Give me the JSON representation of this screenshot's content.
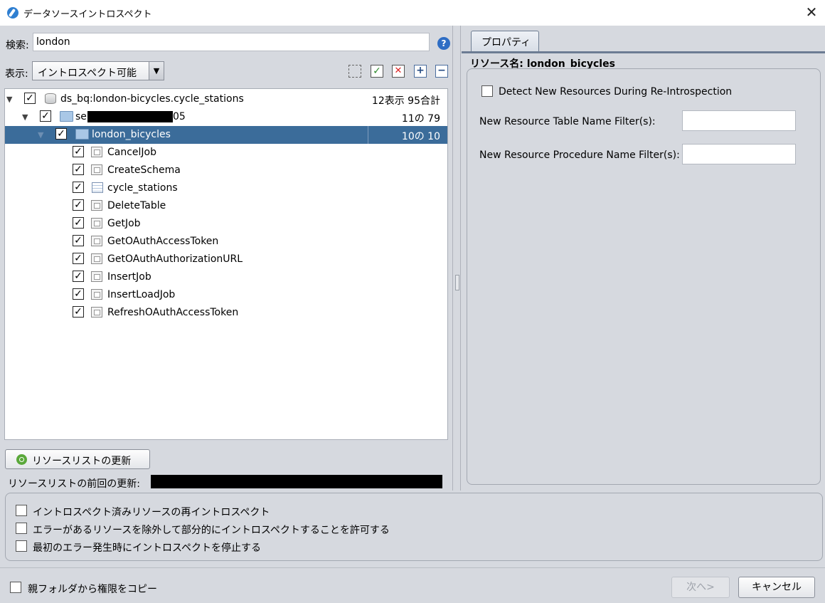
{
  "window": {
    "title": "データソースイントロスペクト",
    "close_glyph": "✕"
  },
  "search": {
    "label": "検索:",
    "value": "london",
    "help_glyph": "?"
  },
  "display": {
    "label": "表示:",
    "selected": "イントロスペクト可能"
  },
  "tree": {
    "root": {
      "label": "ds_bq:london-bicycles.cycle_stations",
      "count": "12表示 95合計",
      "checked": "✓"
    },
    "schema": {
      "label_prefix": "se",
      "label_suffix": "05",
      "count": "11の 79",
      "checked": "✓"
    },
    "dataset": {
      "label": "london_bicycles",
      "count": "10の 10",
      "checked": "✓"
    },
    "items": [
      {
        "label": "CancelJob",
        "checked": "✓"
      },
      {
        "label": "CreateSchema",
        "checked": "✓"
      },
      {
        "label": "cycle_stations",
        "checked": "✓"
      },
      {
        "label": "DeleteTable",
        "checked": "✓"
      },
      {
        "label": "GetJob",
        "checked": "✓"
      },
      {
        "label": "GetOAuthAccessToken",
        "checked": "✓"
      },
      {
        "label": "GetOAuthAuthorizationURL",
        "checked": "✓"
      },
      {
        "label": "InsertJob",
        "checked": "✓"
      },
      {
        "label": "InsertLoadJob",
        "checked": "✓"
      },
      {
        "label": "RefreshOAuthAccessToken",
        "checked": "✓"
      }
    ]
  },
  "refresh": {
    "button_label": "リソースリストの更新",
    "last_label": "リソースリストの前回の更新:"
  },
  "properties": {
    "tab_label": "プロパティ",
    "resource_name": "リソース名: london_bicycles",
    "detect_label": "Detect New Resources During Re-Introspection",
    "table_filter_label": "New Resource Table Name Filter(s):",
    "table_filter_value": "",
    "procedure_filter_label": "New Resource Procedure Name Filter(s):",
    "procedure_filter_value": ""
  },
  "options": [
    "イントロスペクト済みリソースの再イントロスペクト",
    "エラーがあるリソースを除外して部分的にイントロスペクトすることを許可する",
    "最初のエラー発生時にイントロスペクトを停止する"
  ],
  "footer": {
    "copy_permissions": "親フォルダから権限をコピー",
    "next": "次へ>",
    "cancel": "キャンセル"
  },
  "colors": {
    "selected_row": "#3b6c9a",
    "background": "#d6d9df"
  }
}
